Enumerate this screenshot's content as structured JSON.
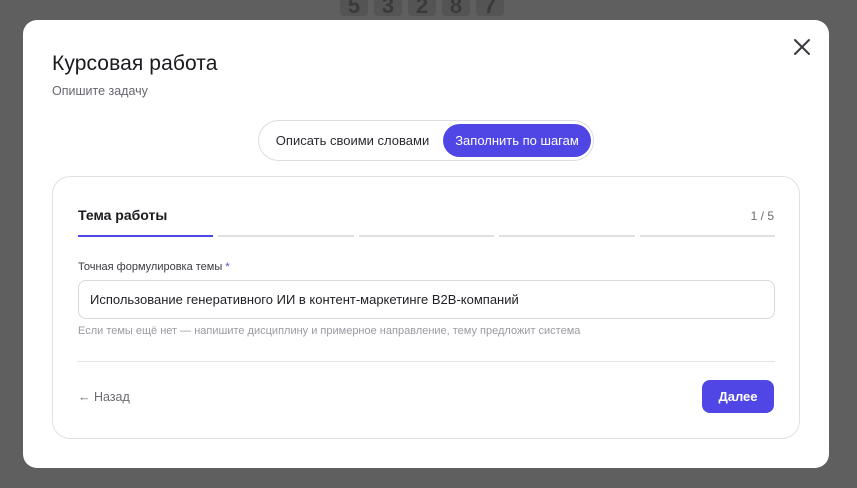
{
  "background": {
    "digits": [
      "5",
      "3",
      "2",
      "8",
      "7"
    ]
  },
  "modal": {
    "title": "Курсовая работа",
    "subtitle": "Опишите задачу",
    "close_icon": "close-icon",
    "mode_toggle": {
      "options": [
        "Описать своими словами",
        "Заполнить по шагам"
      ],
      "selected": "Заполнить по шагам"
    },
    "step": {
      "title": "Тема работы",
      "counter": "1 / 5",
      "current": 1,
      "total": 5,
      "field_label": "Точная формулировка темы",
      "required_mark": "*",
      "field_value": "Использование генеративного ИИ в контент-маркетинге B2B-компаний",
      "hint": "Если темы ещё нет — напишите дисциплину и примерное направление, тему предложит система",
      "back_label": "← Назад",
      "next_label": "Далее"
    }
  },
  "colors": {
    "accent": "#5046e5",
    "overlay": "#5f5f5f"
  }
}
